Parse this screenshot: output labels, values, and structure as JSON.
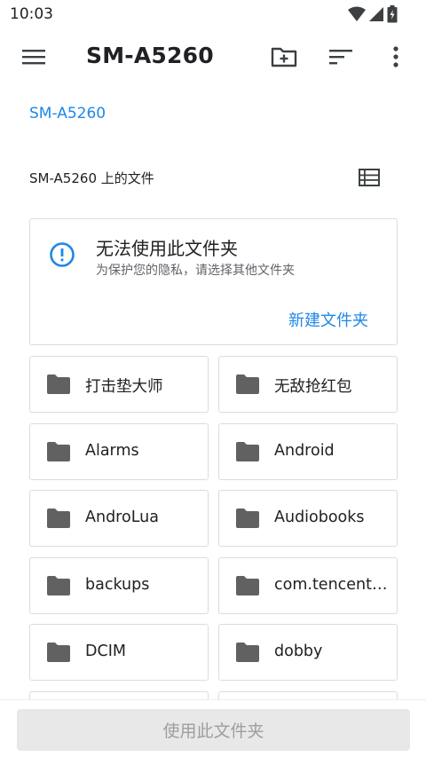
{
  "status_bar": {
    "time": "10:03",
    "icons": [
      "wifi-icon",
      "cellular-signal-icon",
      "battery-icon"
    ]
  },
  "app_bar": {
    "title": "SM-A5260",
    "icons": [
      "menu-icon",
      "new-folder-icon",
      "sort-icon",
      "more-vert-icon"
    ]
  },
  "breadcrumb": "SM-A5260",
  "section_header": "SM-A5260 上的文件",
  "warning": {
    "title": "无法使用此文件夹",
    "subtitle": "为保护您的隐私，请选择其他文件夹",
    "action": "新建文件夹",
    "icon": "info-icon"
  },
  "folders": [
    {
      "name": "打击垫大师"
    },
    {
      "name": "无敌抢红包"
    },
    {
      "name": "Alarms"
    },
    {
      "name": "Android"
    },
    {
      "name": "AndroLua"
    },
    {
      "name": "Audiobooks"
    },
    {
      "name": "backups"
    },
    {
      "name": "com.tencent...."
    },
    {
      "name": "DCIM"
    },
    {
      "name": "dobby"
    },
    {
      "name": ""
    },
    {
      "name": ""
    }
  ],
  "bottom": {
    "use_button": "使用此文件夹"
  },
  "colors": {
    "accent": "#1e88e5",
    "folder": "#616161",
    "border": "#dadce0",
    "disabled_button": "#e8e8e8"
  }
}
